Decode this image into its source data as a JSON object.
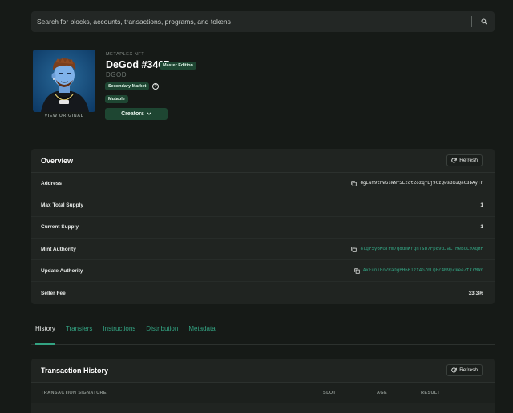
{
  "search": {
    "placeholder": "Search for blocks, accounts, transactions, programs, and tokens"
  },
  "nft": {
    "view_original": "VIEW ORIGINAL",
    "label": "METAPLEX NFT",
    "title": "DeGod #3467",
    "edition_badge": "Master Edition",
    "symbol": "DGOD",
    "secondary_badge": "Secondary Market",
    "mutable_badge": "Mutable",
    "creators_label": "Creators"
  },
  "overview": {
    "title": "Overview",
    "refresh_label": "Refresh",
    "rows": [
      {
        "label": "Address",
        "value": "8gEuh9thWSsWNf5LzqtZozqfEj9CzQwsDXuQaC8bAyTP"
      },
      {
        "label": "Max Total Supply",
        "value": "1"
      },
      {
        "label": "Current Supply",
        "value": "1"
      },
      {
        "label": "Mint Authority",
        "value": "8tgPSy6KGTPm7q8dmWrqnfsb7Fp89dJaCjHeBoL9XqHP"
      },
      {
        "label": "Update Authority",
        "value": "AxFuniPo7RaDgPH661zf4GZmLQFc4M9pckeeZfkrMWn"
      },
      {
        "label": "Seller Fee",
        "value": "33.3%"
      }
    ]
  },
  "tabs": [
    "History",
    "Transfers",
    "Instructions",
    "Distribution",
    "Metadata"
  ],
  "history": {
    "title": "Transaction History",
    "refresh_label": "Refresh",
    "columns": [
      "TRANSACTION SIGNATURE",
      "SLOT",
      "AGE",
      "RESULT"
    ]
  },
  "colors": {
    "accent": "#33a382",
    "badge_bg": "#1e4632",
    "page_bg": "#161a17",
    "card_bg": "#202421"
  },
  "icons": [
    "search-icon",
    "help-icon",
    "chevron-down-icon",
    "refresh-icon",
    "copy-icon"
  ]
}
